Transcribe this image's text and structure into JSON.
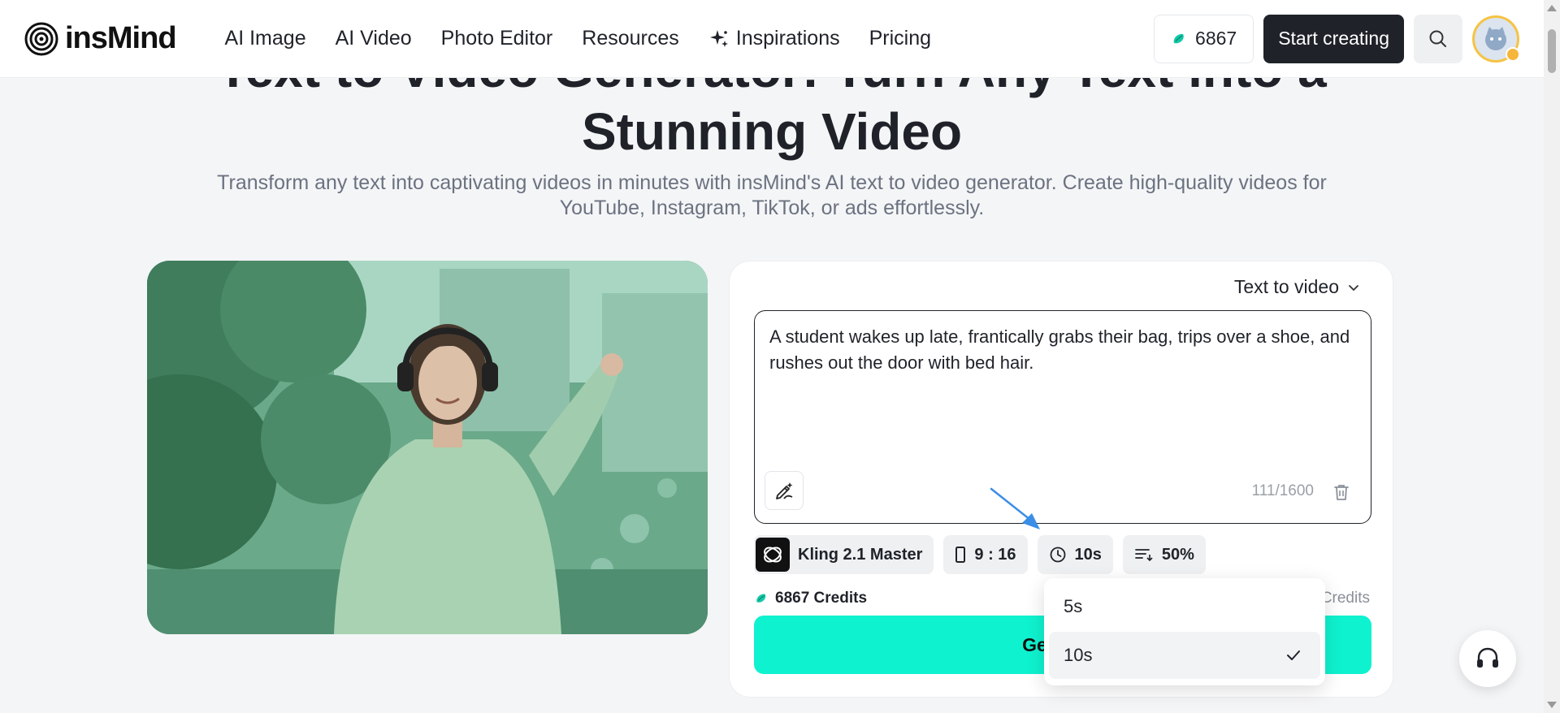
{
  "brand": {
    "name": "insMind"
  },
  "nav": {
    "items": [
      {
        "label": "AI Image"
      },
      {
        "label": "AI Video"
      },
      {
        "label": "Photo Editor"
      },
      {
        "label": "Resources"
      },
      {
        "label": "Inspirations",
        "icon": "sparkle-icon"
      },
      {
        "label": "Pricing"
      }
    ]
  },
  "header": {
    "credits": "6867",
    "start_label": "Start creating",
    "search_icon": "search-icon",
    "avatar_icon": "github-cat-avatar"
  },
  "hero": {
    "title_line1": "Text to Video Generator: Turn Any Text into a",
    "title_line2": "Stunning Video",
    "subtitle": "Transform any text into captivating videos in minutes with insMind's AI text to video generator. Create high-quality videos for YouTube, Instagram, TikTok, or ads effortlessly."
  },
  "panel": {
    "mode_label": "Text to video",
    "prompt": "A student wakes up late, frantically grabs their bag, trips over a shoe, and rushes out the door with bed hair.",
    "char_count": "111/1600",
    "options": {
      "model": "Kling 2.1 Master",
      "ratio": "9 : 16",
      "duration": "10s",
      "quality": "50%"
    },
    "credits_label": "6867 Credits",
    "credits_cost_suffix": "Credits",
    "generate_label": "Generate"
  },
  "duration_dropdown": {
    "options": [
      "5s",
      "10s"
    ],
    "selected": "10s"
  },
  "colors": {
    "accent": "#0ff2cf",
    "dark": "#1f2329",
    "credit_icon": "#13c9a7",
    "annotation_arrow": "#3b8ee6"
  }
}
